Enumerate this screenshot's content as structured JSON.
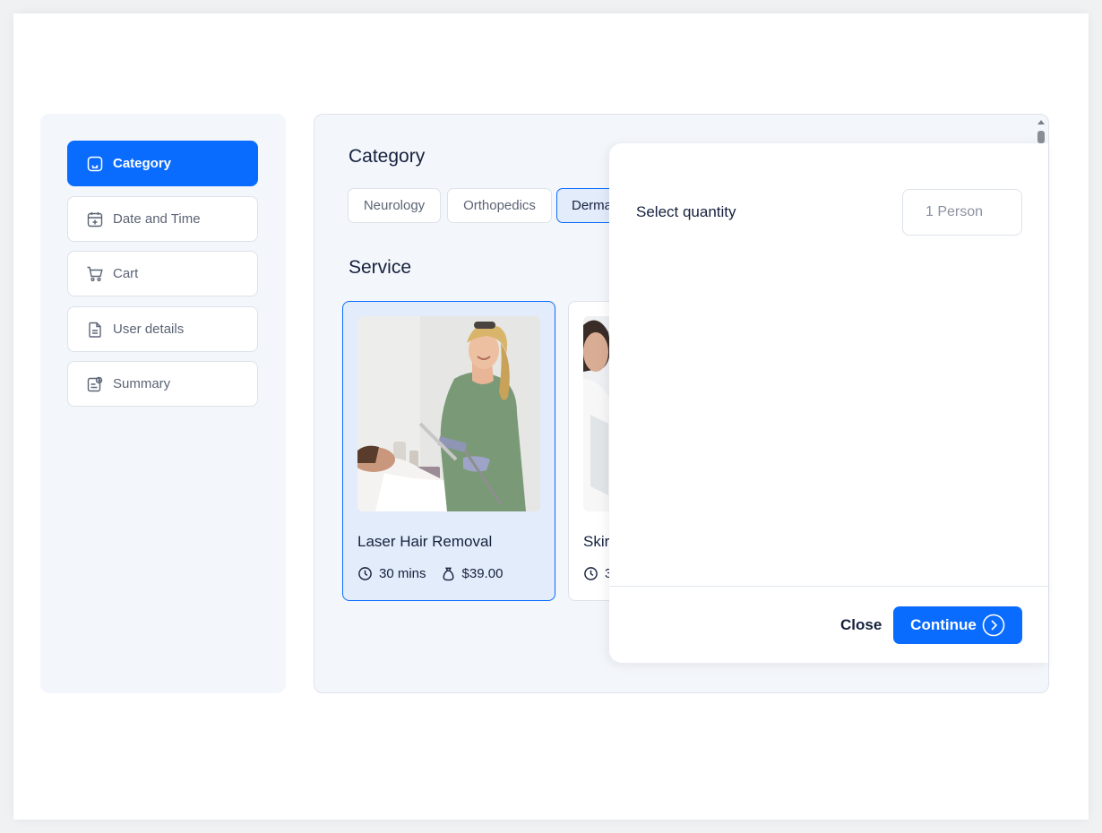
{
  "sidebar": {
    "items": [
      {
        "label": "Category",
        "icon": "category-icon",
        "active": true
      },
      {
        "label": "Date and Time",
        "icon": "calendar-icon",
        "active": false
      },
      {
        "label": "Cart",
        "icon": "cart-icon",
        "active": false
      },
      {
        "label": "User details",
        "icon": "document-icon",
        "active": false
      },
      {
        "label": "Summary",
        "icon": "summary-icon",
        "active": false
      }
    ]
  },
  "main": {
    "category_title": "Category",
    "categories": [
      {
        "label": "Neurology",
        "selected": false
      },
      {
        "label": "Orthopedics",
        "selected": false
      },
      {
        "label": "Derma",
        "selected": true
      }
    ],
    "service_title": "Service",
    "services": [
      {
        "name": "Laser Hair Removal",
        "duration": "30 mins",
        "price": "$39.00",
        "selected": true
      },
      {
        "name": "Skir",
        "duration": "3",
        "price": "",
        "selected": false
      }
    ]
  },
  "modal": {
    "quantity_label": "Select quantity",
    "quantity_value": "1 Person",
    "close_label": "Close",
    "continue_label": "Continue"
  },
  "colors": {
    "accent": "#0a6cff",
    "selected_bg": "#e3ecfa",
    "panel_bg": "#f3f6fa",
    "text": "#16213e"
  }
}
